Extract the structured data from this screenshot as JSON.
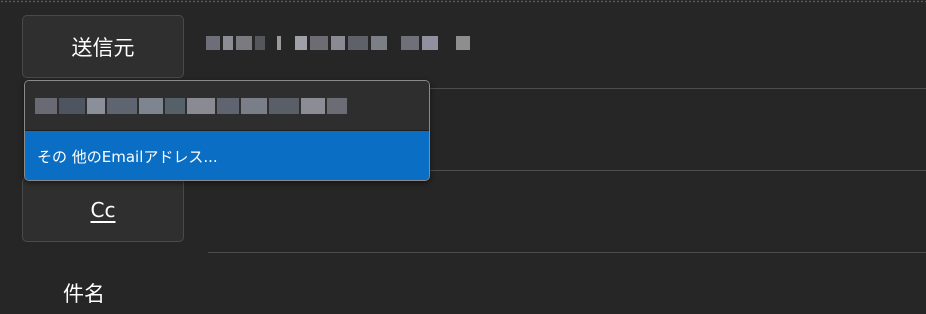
{
  "fields": {
    "from_label": "送信元",
    "cc_label": "Cc",
    "subject_label": "件名"
  },
  "account_dropdown": {
    "other_address_option": "その 他のEmailアドレス..."
  },
  "colors": {
    "background": "#262626",
    "button_background": "#2f2f2f",
    "selected_option": "#0a6fc4",
    "divider": "#4d4d4d"
  }
}
